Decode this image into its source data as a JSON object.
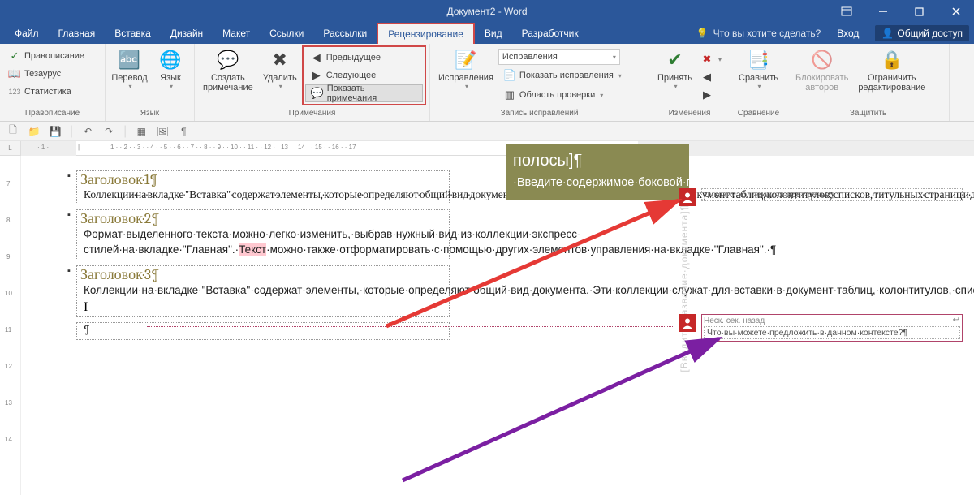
{
  "title": "Документ2 - Word",
  "menu": {
    "file": "Файл",
    "home": "Главная",
    "insert": "Вставка",
    "design": "Дизайн",
    "layout": "Макет",
    "references": "Ссылки",
    "mailings": "Рассылки",
    "review": "Рецензирование",
    "view": "Вид",
    "developer": "Разработчик",
    "tellme": "Что вы хотите сделать?",
    "signin": "Вход",
    "share": "Общий доступ"
  },
  "ribbon": {
    "proofing": {
      "spelling": "Правописание",
      "thesaurus": "Тезаурус",
      "stats": "Статистика",
      "label": "Правописание"
    },
    "language": {
      "translate": "Перевод",
      "lang": "Язык",
      "label": "Язык"
    },
    "comments": {
      "new": "Создать\nпримечание",
      "delete": "Удалить",
      "prev": "Предыдущее",
      "next": "Следующее",
      "show": "Показать примечания",
      "label": "Примечания"
    },
    "tracking": {
      "track": "Исправления",
      "display": "Исправления",
      "showmarkup": "Показать исправления",
      "pane": "Область проверки",
      "label": "Запись исправлений"
    },
    "changes": {
      "accept": "Принять",
      "label": "Изменения"
    },
    "compare": {
      "compare": "Сравнить",
      "label": "Сравнение"
    },
    "protect": {
      "block": "Блокировать\nавторов",
      "restrict": "Ограничить\nредактирование",
      "label": "Защитить"
    }
  },
  "doc": {
    "h1": "Заголовок·1¶",
    "p1": "Коллекции·на·вкладке·\"Вставка\"·содержат·элементы,·которые·определяют·общий·вид·документа.·Эти·коллекции·служат·для·вставки·в·документ·таблиц,·колонтитулов,·списков,·титульных·страниц·и·других·стандартных·блоков.¶",
    "h2": "Заголовок·2¶",
    "p2a": "Формат·выделенного·текста·можно·легко·изменить,·выбрав·нужный·вид·из·коллекции·экспресс-стилей·на·вкладке·\"Главная\".·",
    "p2hl": "Текст",
    "p2b": "·можно·также·отформатировать·с·помощью·других·элементов·управления·на·вкладке·\"Главная\".·¶",
    "h3": "Заголовок·3¶",
    "p3": "Коллекции·на·вкладке·\"Вставка\"·содержат·элементы,·которые·определяют·общий·вид·документа.·Эти·коллекции·служат·для·вставки·в·документ·таблиц,·колонтитулов,·списков,·титульных·страниц·и·других·стандартных·блоков.¶",
    "pend": "¶",
    "sidebar_title": "полосы]¶",
    "sidebar_body": "·Введите·содержимое·боковой·полосы.·Боковая·полоса·представляет·собой·независимое·дополнение·к·основному·документу.·Обычно·она·выровнена·по·левому·или·правому·краю·",
    "vtext": "[Введите·название·документа]¶"
  },
  "comments": {
    "c1": {
      "text": "О·каких·коллекциях·идет·речь?¶"
    },
    "c2": {
      "meta": "Неск. сек. назад",
      "text": "Что·вы·можете·предложить·в·данном·контексте?¶"
    }
  }
}
